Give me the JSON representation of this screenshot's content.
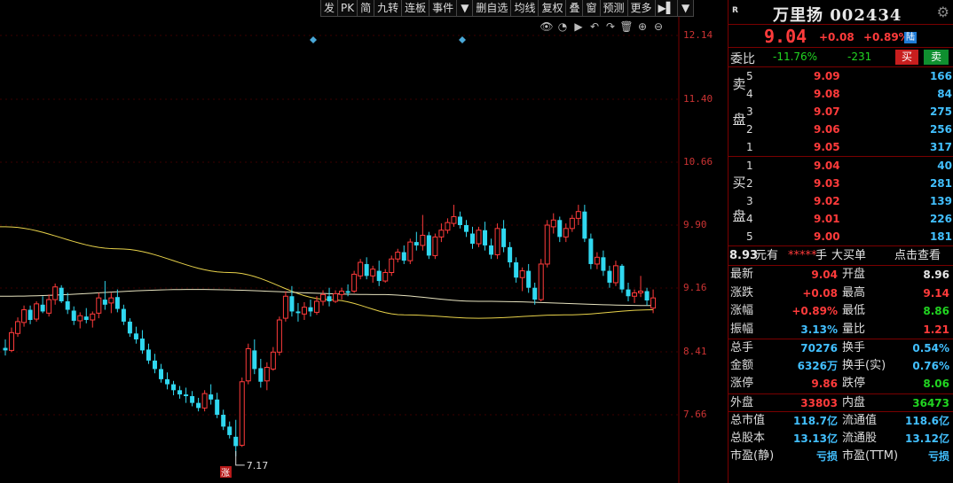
{
  "toolbar": [
    "发",
    "PK",
    "简",
    "九转",
    "连板",
    "事件",
    "▼",
    "删自选",
    "均线",
    "复权",
    "叠",
    "窗",
    "预测",
    "更多",
    "▶▌",
    "▼"
  ],
  "chart_tools": {
    "eye": "👁",
    "lock": "◔",
    "play": "▶",
    "undo": "↶",
    "redo": "↷",
    "delete": "🗑",
    "zoom_in": "⊕",
    "zoom_out": "⊖"
  },
  "y_axis": [
    "12.14",
    "11.40",
    "10.66",
    "9.90",
    "9.16",
    "8.41",
    "7.66"
  ],
  "low_marker": {
    "label": "7.17",
    "badge": "涨"
  },
  "colors": {
    "up": "#ff3b3b",
    "down": "#30d8f0",
    "ma1": "#e8e4c0",
    "ma2": "#e8d24a",
    "grid": "#7a0000"
  },
  "chart_data": {
    "type": "candlestick",
    "y_range": [
      7.17,
      12.14
    ],
    "candles": [
      [
        8.45,
        8.55,
        8.36,
        8.42
      ],
      [
        8.42,
        8.69,
        8.4,
        8.63
      ],
      [
        8.62,
        8.81,
        8.58,
        8.76
      ],
      [
        8.75,
        8.95,
        8.7,
        8.9
      ],
      [
        8.9,
        8.95,
        8.73,
        8.78
      ],
      [
        8.79,
        9.0,
        8.76,
        8.97
      ],
      [
        8.96,
        9.06,
        8.86,
        8.88
      ],
      [
        8.86,
        9.08,
        8.82,
        9.02
      ],
      [
        9.02,
        9.21,
        8.96,
        9.17
      ],
      [
        9.16,
        9.19,
        8.98,
        9.0
      ],
      [
        9.0,
        9.1,
        8.85,
        8.9
      ],
      [
        8.89,
        8.94,
        8.72,
        8.77
      ],
      [
        8.77,
        8.87,
        8.68,
        8.83
      ],
      [
        8.82,
        8.92,
        8.74,
        8.78
      ],
      [
        8.78,
        8.88,
        8.69,
        8.85
      ],
      [
        8.86,
        9.1,
        8.8,
        9.04
      ],
      [
        9.02,
        9.24,
        8.9,
        8.96
      ],
      [
        8.98,
        9.1,
        8.86,
        9.04
      ],
      [
        9.05,
        9.14,
        8.87,
        8.91
      ],
      [
        8.91,
        8.96,
        8.72,
        8.76
      ],
      [
        8.76,
        8.8,
        8.58,
        8.62
      ],
      [
        8.62,
        8.7,
        8.5,
        8.55
      ],
      [
        8.56,
        8.66,
        8.38,
        8.42
      ],
      [
        8.43,
        8.5,
        8.26,
        8.3
      ],
      [
        8.3,
        8.38,
        8.15,
        8.2
      ],
      [
        8.2,
        8.26,
        8.04,
        8.08
      ],
      [
        8.08,
        8.16,
        7.96,
        8.02
      ],
      [
        8.02,
        8.06,
        7.89,
        7.95
      ],
      [
        7.95,
        8.0,
        7.85,
        7.9
      ],
      [
        7.9,
        7.98,
        7.8,
        7.88
      ],
      [
        7.88,
        7.94,
        7.76,
        7.8
      ],
      [
        7.8,
        7.86,
        7.7,
        7.74
      ],
      [
        7.74,
        7.95,
        7.7,
        7.91
      ],
      [
        7.9,
        8.02,
        7.78,
        7.84
      ],
      [
        7.84,
        7.92,
        7.62,
        7.66
      ],
      [
        7.66,
        7.72,
        7.48,
        7.52
      ],
      [
        7.52,
        7.58,
        7.38,
        7.42
      ],
      [
        7.4,
        7.6,
        7.17,
        7.29
      ],
      [
        7.3,
        8.1,
        7.28,
        8.05
      ],
      [
        8.06,
        8.5,
        8.02,
        8.44
      ],
      [
        8.42,
        8.55,
        8.14,
        8.2
      ],
      [
        8.21,
        8.32,
        7.98,
        8.05
      ],
      [
        8.06,
        8.28,
        7.95,
        8.22
      ],
      [
        8.2,
        8.46,
        8.18,
        8.4
      ],
      [
        8.4,
        8.82,
        8.36,
        8.78
      ],
      [
        8.8,
        9.12,
        8.76,
        9.06
      ],
      [
        9.06,
        9.18,
        8.82,
        8.88
      ],
      [
        8.88,
        8.98,
        8.76,
        8.86
      ],
      [
        8.85,
        8.99,
        8.78,
        8.93
      ],
      [
        8.93,
        9.02,
        8.82,
        8.88
      ],
      [
        8.87,
        9.06,
        8.84,
        9.0
      ],
      [
        9.0,
        9.13,
        8.95,
        9.08
      ],
      [
        9.06,
        9.16,
        8.94,
        9.0
      ],
      [
        9.0,
        9.13,
        8.98,
        9.09
      ],
      [
        9.08,
        9.16,
        9.02,
        9.12
      ],
      [
        9.12,
        9.2,
        9.06,
        9.1
      ],
      [
        9.12,
        9.36,
        9.1,
        9.32
      ],
      [
        9.3,
        9.5,
        9.26,
        9.46
      ],
      [
        9.44,
        9.52,
        9.26,
        9.3
      ],
      [
        9.3,
        9.42,
        9.22,
        9.38
      ],
      [
        9.36,
        9.48,
        9.18,
        9.24
      ],
      [
        9.24,
        9.38,
        9.22,
        9.34
      ],
      [
        9.34,
        9.54,
        9.3,
        9.5
      ],
      [
        9.5,
        9.62,
        9.46,
        9.58
      ],
      [
        9.58,
        9.66,
        9.44,
        9.48
      ],
      [
        9.48,
        9.74,
        9.44,
        9.7
      ],
      [
        9.7,
        9.82,
        9.6,
        9.66
      ],
      [
        9.66,
        10.02,
        9.6,
        9.78
      ],
      [
        9.78,
        9.82,
        9.5,
        9.54
      ],
      [
        9.54,
        9.8,
        9.5,
        9.76
      ],
      [
        9.76,
        9.92,
        9.7,
        9.84
      ],
      [
        9.84,
        9.98,
        9.8,
        9.93
      ],
      [
        9.92,
        10.14,
        9.88,
        10.0
      ],
      [
        10.0,
        10.06,
        9.86,
        9.9
      ],
      [
        9.9,
        9.96,
        9.76,
        9.82
      ],
      [
        9.8,
        9.88,
        9.62,
        9.68
      ],
      [
        9.68,
        9.88,
        9.64,
        9.84
      ],
      [
        9.84,
        9.94,
        9.6,
        9.66
      ],
      [
        9.66,
        9.74,
        9.5,
        9.55
      ],
      [
        9.55,
        9.92,
        9.5,
        9.86
      ],
      [
        9.86,
        9.96,
        9.58,
        9.64
      ],
      [
        9.64,
        9.7,
        9.4,
        9.46
      ],
      [
        9.46,
        9.52,
        9.22,
        9.28
      ],
      [
        9.28,
        9.4,
        9.12,
        9.36
      ],
      [
        9.36,
        9.44,
        9.1,
        9.16
      ],
      [
        9.16,
        9.22,
        8.96,
        9.02
      ],
      [
        9.02,
        9.5,
        9.0,
        9.44
      ],
      [
        9.44,
        9.96,
        9.4,
        9.9
      ],
      [
        9.88,
        10.04,
        9.8,
        9.96
      ],
      [
        9.96,
        10.0,
        9.7,
        9.76
      ],
      [
        9.76,
        9.92,
        9.7,
        9.86
      ],
      [
        9.86,
        10.02,
        9.82,
        9.98
      ],
      [
        9.98,
        10.14,
        9.9,
        10.06
      ],
      [
        10.06,
        10.14,
        9.7,
        9.74
      ],
      [
        9.74,
        9.8,
        9.38,
        9.44
      ],
      [
        9.44,
        9.58,
        9.38,
        9.52
      ],
      [
        9.52,
        9.6,
        9.3,
        9.36
      ],
      [
        9.36,
        9.42,
        9.16,
        9.22
      ],
      [
        9.22,
        9.48,
        9.18,
        9.42
      ],
      [
        9.42,
        9.44,
        9.1,
        9.14
      ],
      [
        9.14,
        9.22,
        9.0,
        9.06
      ],
      [
        9.06,
        9.14,
        8.98,
        9.1
      ],
      [
        9.1,
        9.3,
        9.05,
        9.12
      ],
      [
        9.12,
        9.16,
        8.95,
        9.01
      ],
      [
        8.92,
        9.14,
        8.86,
        9.04
      ]
    ],
    "ma1": [
      [
        0,
        9.06
      ],
      [
        30,
        9.14
      ],
      [
        60,
        9.08
      ],
      [
        76,
        9.0
      ],
      [
        104,
        8.95
      ]
    ],
    "ma2": [
      [
        0,
        9.88
      ],
      [
        18,
        9.62
      ],
      [
        36,
        9.34
      ],
      [
        52,
        9.02
      ],
      [
        64,
        8.84
      ],
      [
        76,
        8.8
      ],
      [
        90,
        8.84
      ],
      [
        104,
        8.9
      ]
    ]
  },
  "panel": {
    "badge": "R",
    "name": "万里扬 002434",
    "price": "9.04",
    "change": "+0.08",
    "change_pct": "+0.89%",
    "exchange_tag": "陆",
    "webi_label": "委比",
    "webi_pct": "-11.76%",
    "webi_diff": "-231",
    "buy_btn": "买",
    "sell_btn": "卖",
    "sell_side": "卖盘",
    "buy_side": "买盘",
    "asks": [
      {
        "lv": "5",
        "price": "9.09",
        "vol": "166"
      },
      {
        "lv": "4",
        "price": "9.08",
        "vol": "84"
      },
      {
        "lv": "3",
        "price": "9.07",
        "vol": "275"
      },
      {
        "lv": "2",
        "price": "9.06",
        "vol": "256"
      },
      {
        "lv": "1",
        "price": "9.05",
        "vol": "317"
      }
    ],
    "bids": [
      {
        "lv": "1",
        "price": "9.04",
        "vol": "40"
      },
      {
        "lv": "2",
        "price": "9.03",
        "vol": "281"
      },
      {
        "lv": "3",
        "price": "9.02",
        "vol": "139"
      },
      {
        "lv": "4",
        "price": "9.01",
        "vol": "226"
      },
      {
        "lv": "5",
        "price": "9.00",
        "vol": "181"
      }
    ],
    "ticker": {
      "price": "8.93",
      "unit": "元有",
      "stars": "*****",
      "hand": "手",
      "big": "大买单",
      "link": "点击查看"
    },
    "stats": [
      {
        "l1": "最新",
        "v1": "9.04",
        "c1": "red",
        "l2": "开盘",
        "v2": "8.96",
        "c2": "white"
      },
      {
        "l1": "涨跌",
        "v1": "+0.08",
        "c1": "red",
        "l2": "最高",
        "v2": "9.14",
        "c2": "red"
      },
      {
        "l1": "涨幅",
        "v1": "+0.89%",
        "c1": "red",
        "l2": "最低",
        "v2": "8.86",
        "c2": "green"
      },
      {
        "l1": "振幅",
        "v1": "3.13%",
        "c1": "cyan",
        "l2": "量比",
        "v2": "1.21",
        "c2": "red"
      },
      {
        "l1": "总手",
        "v1": "70276",
        "c1": "cyan",
        "l2": "换手",
        "v2": "0.54%",
        "c2": "cyan"
      },
      {
        "l1": "金额",
        "v1": "6326万",
        "c1": "cyan",
        "l2": "换手(实)",
        "v2": "0.76%",
        "c2": "cyan"
      },
      {
        "l1": "涨停",
        "v1": "9.86",
        "c1": "red",
        "l2": "跌停",
        "v2": "8.06",
        "c2": "green"
      },
      {
        "l1": "外盘",
        "v1": "33803",
        "c1": "red",
        "l2": "内盘",
        "v2": "36473",
        "c2": "green"
      },
      {
        "l1": "总市值",
        "v1": "118.7亿",
        "c1": "cyan",
        "l2": "流通值",
        "v2": "118.6亿",
        "c2": "cyan"
      },
      {
        "l1": "总股本",
        "v1": "13.13亿",
        "c1": "cyan",
        "l2": "流通股",
        "v2": "13.12亿",
        "c2": "cyan"
      },
      {
        "l1": "市盈(静)",
        "v1": "亏损",
        "c1": "cyan",
        "l2": "市盈(TTM)",
        "v2": "亏损",
        "c2": "cyan"
      }
    ]
  }
}
